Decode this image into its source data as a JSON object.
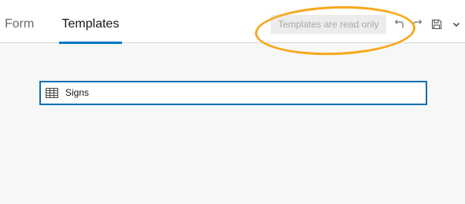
{
  "header": {
    "tabs": [
      {
        "label": "Form",
        "active": false
      },
      {
        "label": "Templates",
        "active": true
      }
    ],
    "status_text": "Templates are read only",
    "tools": [
      "undo-icon",
      "redo-icon",
      "save-icon",
      "chevron-down-icon"
    ]
  },
  "main": {
    "layers": [
      {
        "name": "Signs",
        "icon": "table-icon"
      }
    ]
  },
  "colors": {
    "accent": "#0079c1",
    "selection_border": "#0e6fb5",
    "annotation": "#f7a81b",
    "background": "#f7f7f7"
  }
}
